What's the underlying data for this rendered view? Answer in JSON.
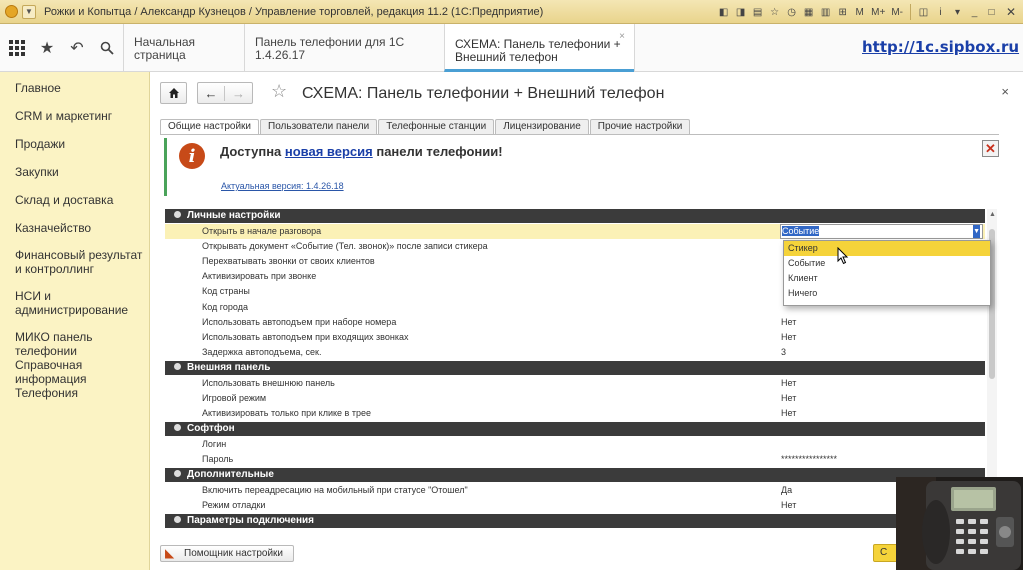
{
  "titlebar": {
    "title": "Рожки и Копытца / Александр Кузнецов / Управление торговлей, редакция 11.2  (1С:Предприятие)",
    "buttons": [
      "M",
      "M+",
      "M-"
    ]
  },
  "topnav": {
    "tabs": [
      {
        "label": "Начальная страница"
      },
      {
        "label": "Панель телефонии для 1С 1.4.26.17"
      },
      {
        "label": "СХЕМА: Панель телефонии + Внешний телефон"
      }
    ],
    "site_link": "http://1c.sipbox.ru"
  },
  "sidebar": {
    "items": [
      {
        "label": "Главное"
      },
      {
        "label": "CRM и маркетинг"
      },
      {
        "label": "Продажи"
      },
      {
        "label": "Закупки"
      },
      {
        "label": "Склад и доставка"
      },
      {
        "label": "Казначейство"
      },
      {
        "label": "Финансовый результат и контроллинг"
      },
      {
        "label": "НСИ и администрирование"
      },
      {
        "label": "МИКО панель телефонии"
      },
      {
        "label": "Справочная информация"
      },
      {
        "label": "Телефония"
      }
    ]
  },
  "form": {
    "title": "СХЕМА: Панель телефонии + Внешний телефон",
    "tabs": [
      {
        "label": "Общие настройки"
      },
      {
        "label": "Пользователи панели"
      },
      {
        "label": "Телефонные станции"
      },
      {
        "label": "Лицензирование"
      },
      {
        "label": "Прочие настройки"
      }
    ],
    "notice": {
      "text_before": "Доступна ",
      "link": "новая версия",
      "text_after": " панели телефонии!",
      "version": "Актуальная версия: 1.4.26.18"
    },
    "groups": [
      {
        "title": "Личные настройки",
        "rows": [
          {
            "name": "Открыть в начале разговора",
            "value": "Событие"
          },
          {
            "name": "Открывать документ «Событие (Тел. звонок)» после записи стикера",
            "value": ""
          },
          {
            "name": "Перехватывать звонки от своих клиентов",
            "value": ""
          },
          {
            "name": "Активизировать при звонке",
            "value": ""
          },
          {
            "name": "Код страны",
            "value": ""
          },
          {
            "name": "Код города",
            "value": ""
          },
          {
            "name": "Использовать автоподъем при наборе номера",
            "value": "Нет"
          },
          {
            "name": "Использовать автоподъем при входящих звонках",
            "value": "Нет"
          },
          {
            "name": "Задержка автоподъема, сек.",
            "value": "3"
          }
        ]
      },
      {
        "title": "Внешняя панель",
        "rows": [
          {
            "name": "Использовать внешнюю панель",
            "value": "Нет"
          },
          {
            "name": "Игровой режим",
            "value": "Нет"
          },
          {
            "name": "Активизировать только при клике в трее",
            "value": "Нет"
          }
        ]
      },
      {
        "title": "Софтфон",
        "rows": [
          {
            "name": "Логин",
            "value": ""
          },
          {
            "name": "Пароль",
            "value": "****************"
          }
        ]
      },
      {
        "title": "Дополнительные",
        "rows": [
          {
            "name": "Включить переадресацию на мобильный при статусе \"Отошел\"",
            "value": "Да"
          },
          {
            "name": "Режим отладки",
            "value": "Нет"
          }
        ]
      },
      {
        "title": "Параметры подключения",
        "rows": []
      }
    ],
    "dropdown_options": [
      "Стикер",
      "Событие",
      "Клиент",
      "Ничего"
    ],
    "dropdown_highlighted": "Стикер",
    "helper_button": "Помощник настройки",
    "save_button": "С"
  }
}
